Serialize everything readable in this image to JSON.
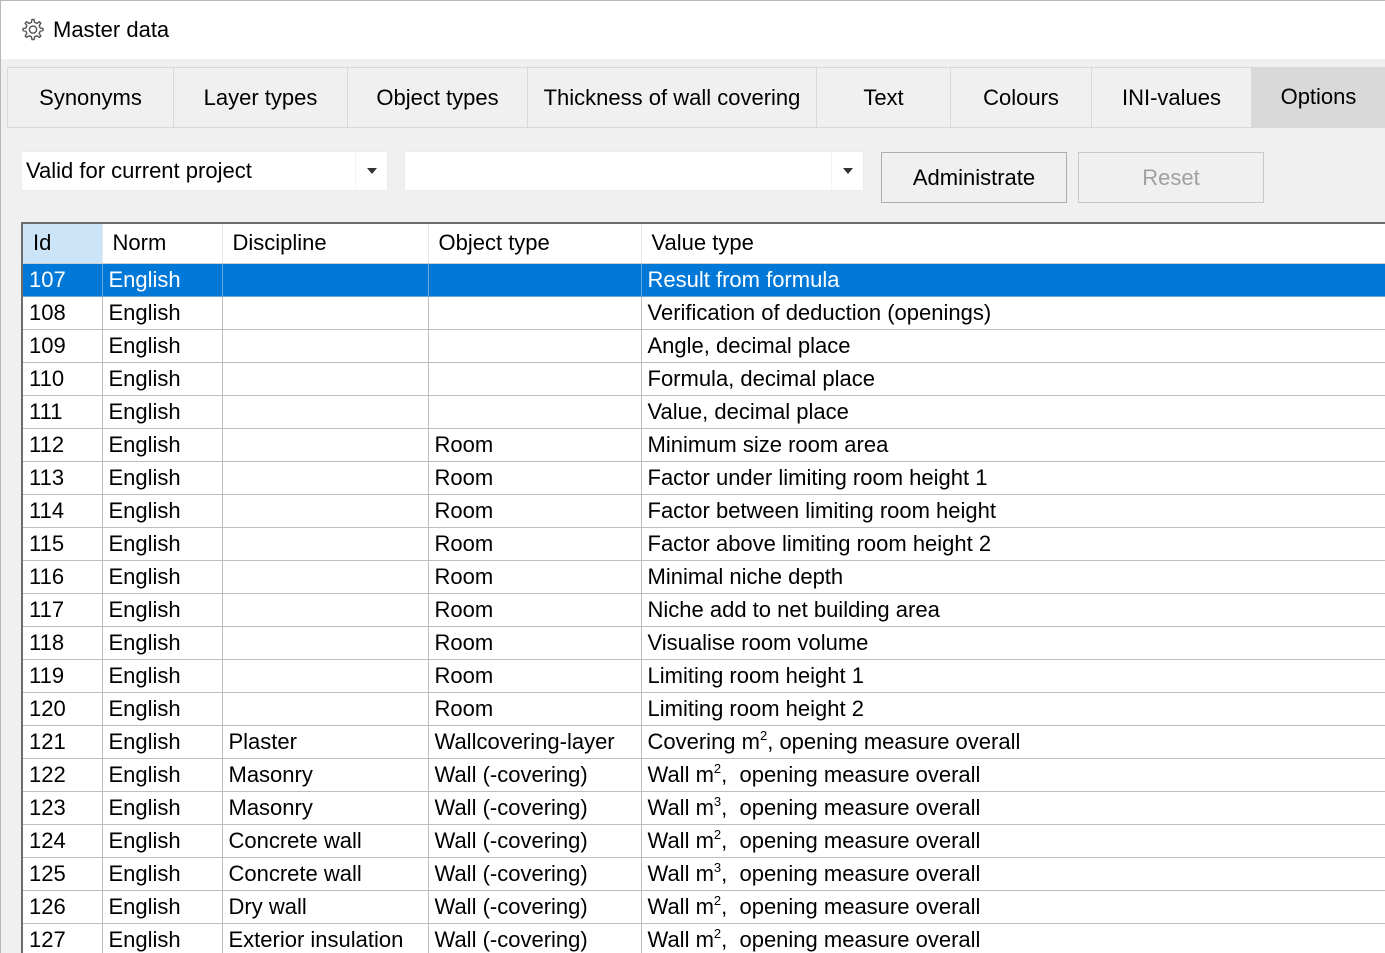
{
  "window": {
    "title": "Master data"
  },
  "tabs": [
    {
      "label": "Synonyms",
      "active": false
    },
    {
      "label": "Layer types",
      "active": false
    },
    {
      "label": "Object types",
      "active": false
    },
    {
      "label": "Thickness of wall covering",
      "active": false
    },
    {
      "label": "Text",
      "active": false
    },
    {
      "label": "Colours",
      "active": false
    },
    {
      "label": "INI-values",
      "active": false
    },
    {
      "label": "Options",
      "active": true
    }
  ],
  "toolbar": {
    "scope_value": "Valid for current project",
    "filter_value": "",
    "administrate_label": "Administrate",
    "reset_label": "Reset"
  },
  "table": {
    "columns": [
      "Id",
      "Norm",
      "Discipline",
      "Object type",
      "Value type"
    ],
    "sorted_column": "Id",
    "selected_id": "107",
    "rows": [
      {
        "id": "107",
        "norm": "English",
        "discipline": "",
        "object_type": "",
        "value_type": "Result from formula"
      },
      {
        "id": "108",
        "norm": "English",
        "discipline": "",
        "object_type": "",
        "value_type": "Verification of deduction (openings)"
      },
      {
        "id": "109",
        "norm": "English",
        "discipline": "",
        "object_type": "",
        "value_type": "Angle, decimal place"
      },
      {
        "id": "110",
        "norm": "English",
        "discipline": "",
        "object_type": "",
        "value_type": "Formula, decimal place"
      },
      {
        "id": "111",
        "norm": "English",
        "discipline": "",
        "object_type": "",
        "value_type": "Value, decimal place"
      },
      {
        "id": "112",
        "norm": "English",
        "discipline": "",
        "object_type": "Room",
        "value_type": "Minimum size room area"
      },
      {
        "id": "113",
        "norm": "English",
        "discipline": "",
        "object_type": "Room",
        "value_type": "Factor under limiting room height 1"
      },
      {
        "id": "114",
        "norm": "English",
        "discipline": "",
        "object_type": "Room",
        "value_type": "Factor between limiting room height"
      },
      {
        "id": "115",
        "norm": "English",
        "discipline": "",
        "object_type": "Room",
        "value_type": "Factor above limiting room height 2"
      },
      {
        "id": "116",
        "norm": "English",
        "discipline": "",
        "object_type": "Room",
        "value_type": "Minimal niche depth"
      },
      {
        "id": "117",
        "norm": "English",
        "discipline": "",
        "object_type": "Room",
        "value_type": "Niche add to net building area"
      },
      {
        "id": "118",
        "norm": "English",
        "discipline": "",
        "object_type": "Room",
        "value_type": "Visualise room volume"
      },
      {
        "id": "119",
        "norm": "English",
        "discipline": "",
        "object_type": "Room",
        "value_type": "Limiting room height 1"
      },
      {
        "id": "120",
        "norm": "English",
        "discipline": "",
        "object_type": "Room",
        "value_type": "Limiting room height 2"
      },
      {
        "id": "121",
        "norm": "English",
        "discipline": "Plaster",
        "object_type": "Wallcovering-layer",
        "value_type": "Covering m",
        "sup": "2",
        "value_suffix": ", opening measure overall"
      },
      {
        "id": "122",
        "norm": "English",
        "discipline": "Masonry",
        "object_type": "Wall (-covering)",
        "value_type": "Wall m",
        "sup": "2",
        "value_suffix": ",  opening measure overall"
      },
      {
        "id": "123",
        "norm": "English",
        "discipline": "Masonry",
        "object_type": "Wall (-covering)",
        "value_type": "Wall m",
        "sup": "3",
        "value_suffix": ",  opening measure overall"
      },
      {
        "id": "124",
        "norm": "English",
        "discipline": "Concrete wall",
        "object_type": "Wall (-covering)",
        "value_type": "Wall m",
        "sup": "2",
        "value_suffix": ",  opening measure overall"
      },
      {
        "id": "125",
        "norm": "English",
        "discipline": "Concrete wall",
        "object_type": "Wall (-covering)",
        "value_type": "Wall m",
        "sup": "3",
        "value_suffix": ",  opening measure overall"
      },
      {
        "id": "126",
        "norm": "English",
        "discipline": "Dry wall",
        "object_type": "Wall (-covering)",
        "value_type": "Wall m",
        "sup": "2",
        "value_suffix": ",  opening measure overall"
      },
      {
        "id": "127",
        "norm": "English",
        "discipline": "Exterior insulation",
        "object_type": "Wall (-covering)",
        "value_type": "Wall m",
        "sup": "2",
        "value_suffix": ",  opening measure overall"
      }
    ]
  },
  "colors": {
    "selection": "#0078d7",
    "sorted_header": "#cce4f7",
    "active_tab": "#d9d9d9"
  },
  "icons": {
    "window_icon": "gear-icon",
    "dropdown": "chevron-down-icon"
  }
}
